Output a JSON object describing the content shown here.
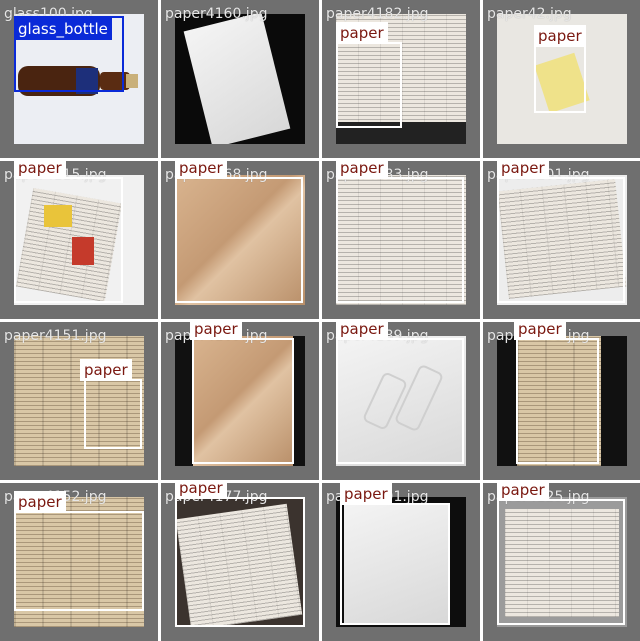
{
  "tiles": [
    {
      "filename": "glass100.jpg",
      "label": "glass_bottle"
    },
    {
      "filename": "paper4160.jpg",
      "label": ""
    },
    {
      "filename": "paper4182.jpg",
      "label": "paper"
    },
    {
      "filename": "paper42.jpg",
      "label": "paper"
    },
    {
      "filename": "paper4115.jpg",
      "label": "paper"
    },
    {
      "filename": "paper4168.jpg",
      "label": "paper"
    },
    {
      "filename": "paper4183.jpg",
      "label": "paper"
    },
    {
      "filename": "paper4201.jpg",
      "label": "paper"
    },
    {
      "filename": "paper4151.jpg",
      "label": "paper"
    },
    {
      "filename": "paper4169.jpg",
      "label": "paper"
    },
    {
      "filename": "paper4189.jpg",
      "label": "paper"
    },
    {
      "filename": "paper4193.jpg",
      "label": "paper"
    },
    {
      "filename": "paper4152.jpg",
      "label": "paper"
    },
    {
      "filename": "paper4177.jpg",
      "label": "paper"
    },
    {
      "filename": "paper4191.jpg",
      "label": "paper"
    },
    {
      "filename": "paper4125.jpg",
      "label": "paper"
    }
  ],
  "colors": {
    "paper_box": "#ffffff",
    "paper_label_text": "#7a1810",
    "glass_box": "#0a2ad8"
  }
}
